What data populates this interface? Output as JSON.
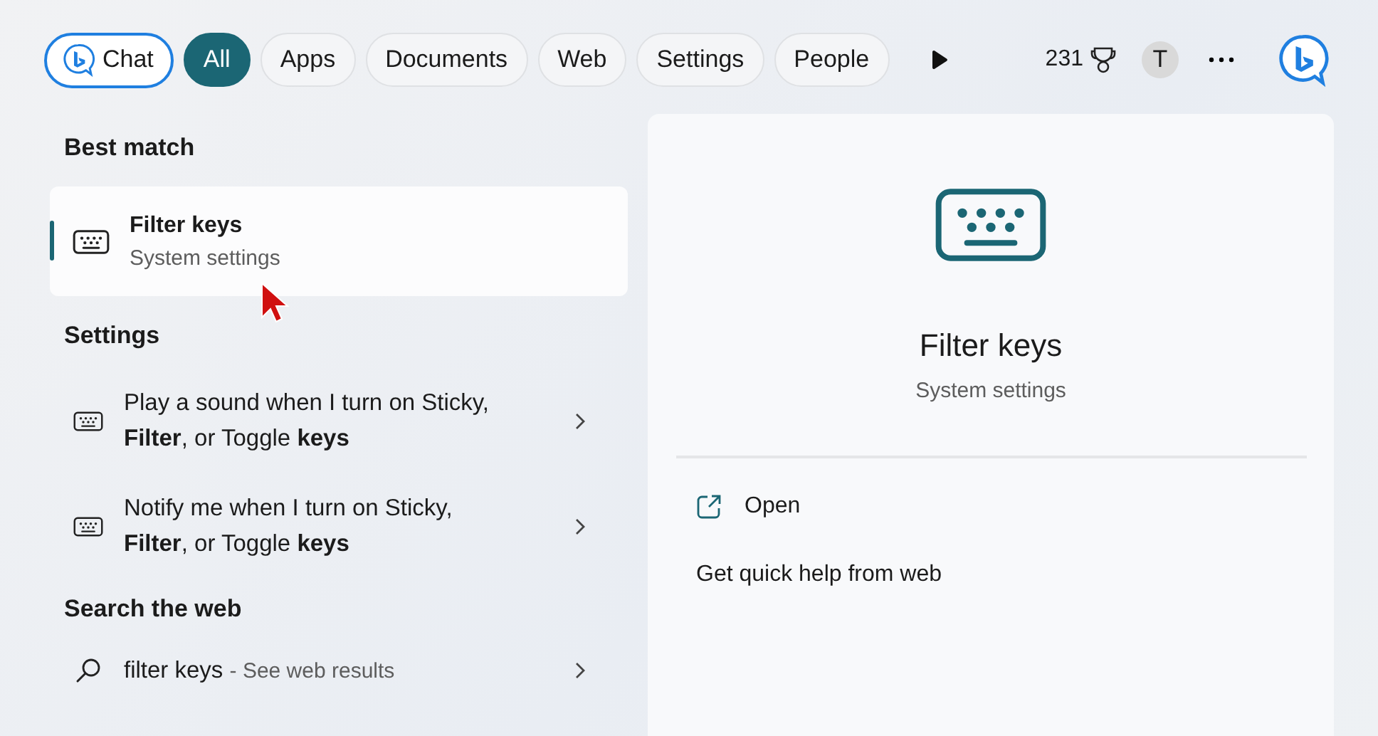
{
  "filters": [
    {
      "label": "Chat",
      "kind": "chat",
      "selected": false
    },
    {
      "label": "All",
      "kind": "tab",
      "selected": true
    },
    {
      "label": "Apps",
      "kind": "tab",
      "selected": false
    },
    {
      "label": "Documents",
      "kind": "tab",
      "selected": false
    },
    {
      "label": "Web",
      "kind": "tab",
      "selected": false
    },
    {
      "label": "Settings",
      "kind": "tab",
      "selected": false
    },
    {
      "label": "People",
      "kind": "tab",
      "selected": false
    }
  ],
  "points": "231",
  "account_initial": "T",
  "best_match": {
    "heading": "Best match",
    "item": {
      "title": "Filter keys",
      "subtitle": "System settings",
      "selected": true
    }
  },
  "settings": {
    "heading": "Settings",
    "items": [
      {
        "text": "Play a sound when I turn on Sticky, **Filter**, or Toggle **keys**",
        "selected": false
      },
      {
        "text": "Notify me when I turn on Sticky, **Filter**, or Toggle **keys**",
        "selected": false
      }
    ]
  },
  "web": {
    "heading": "Search the web",
    "query": "filter keys",
    "suffix": "- See web results"
  },
  "detail": {
    "title": "Filter keys",
    "subtitle": "System settings",
    "actions": [
      {
        "label": "Open",
        "kind": "open"
      },
      {
        "label": "Get quick help from web",
        "kind": "help"
      }
    ]
  }
}
